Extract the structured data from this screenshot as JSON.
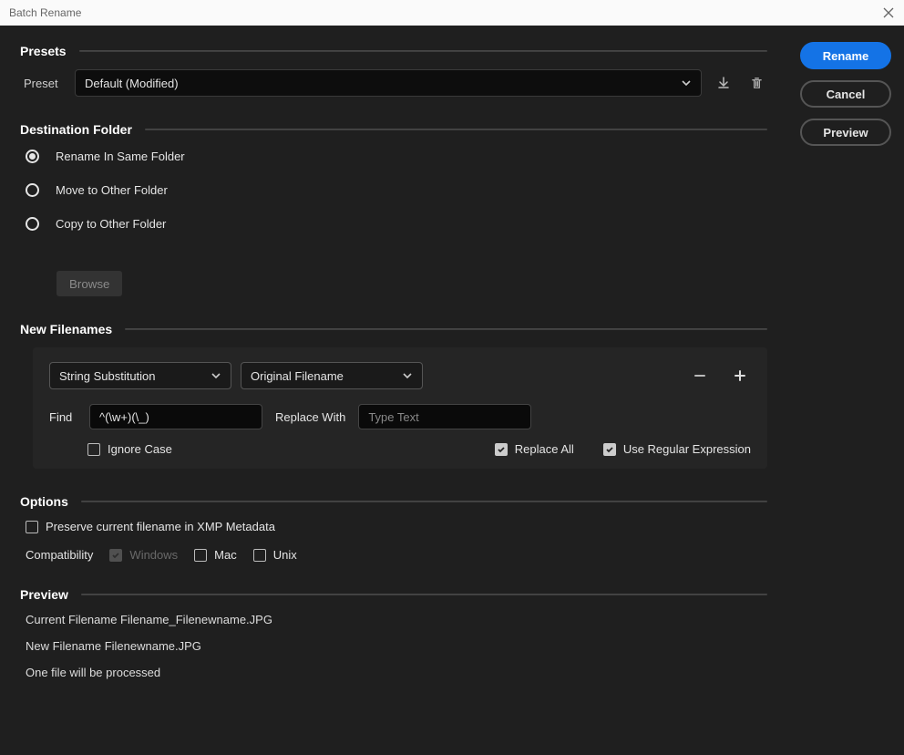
{
  "window": {
    "title": "Batch Rename"
  },
  "sidebar": {
    "rename": "Rename",
    "cancel": "Cancel",
    "preview": "Preview"
  },
  "presets": {
    "heading": "Presets",
    "label": "Preset",
    "selected": "Default (Modified)"
  },
  "destination": {
    "heading": "Destination Folder",
    "options": [
      {
        "label": "Rename In Same Folder",
        "checked": true
      },
      {
        "label": "Move to Other Folder",
        "checked": false
      },
      {
        "label": "Copy to Other Folder",
        "checked": false
      }
    ],
    "browse": "Browse"
  },
  "newFilenames": {
    "heading": "New Filenames",
    "ruleType": "String Substitution",
    "source": "Original Filename",
    "findLabel": "Find",
    "findValue": "^(\\w+)(\\_)",
    "replaceLabel": "Replace With",
    "replacePlaceholder": "Type Text",
    "replaceValue": "",
    "ignoreCase": {
      "label": "Ignore Case",
      "checked": false
    },
    "replaceAll": {
      "label": "Replace All",
      "checked": true
    },
    "useRegex": {
      "label": "Use Regular Expression",
      "checked": true
    }
  },
  "options": {
    "heading": "Options",
    "preserveXmp": {
      "label": "Preserve current filename in XMP Metadata",
      "checked": false
    },
    "compatibilityLabel": "Compatibility",
    "compat": [
      {
        "label": "Windows",
        "checked": true,
        "disabled": true
      },
      {
        "label": "Mac",
        "checked": false,
        "disabled": false
      },
      {
        "label": "Unix",
        "checked": false,
        "disabled": false
      }
    ]
  },
  "preview": {
    "heading": "Preview",
    "current": "Current Filename Filename_Filenewname.JPG",
    "new": "New Filename Filenewname.JPG",
    "summary": "One file will be processed"
  }
}
